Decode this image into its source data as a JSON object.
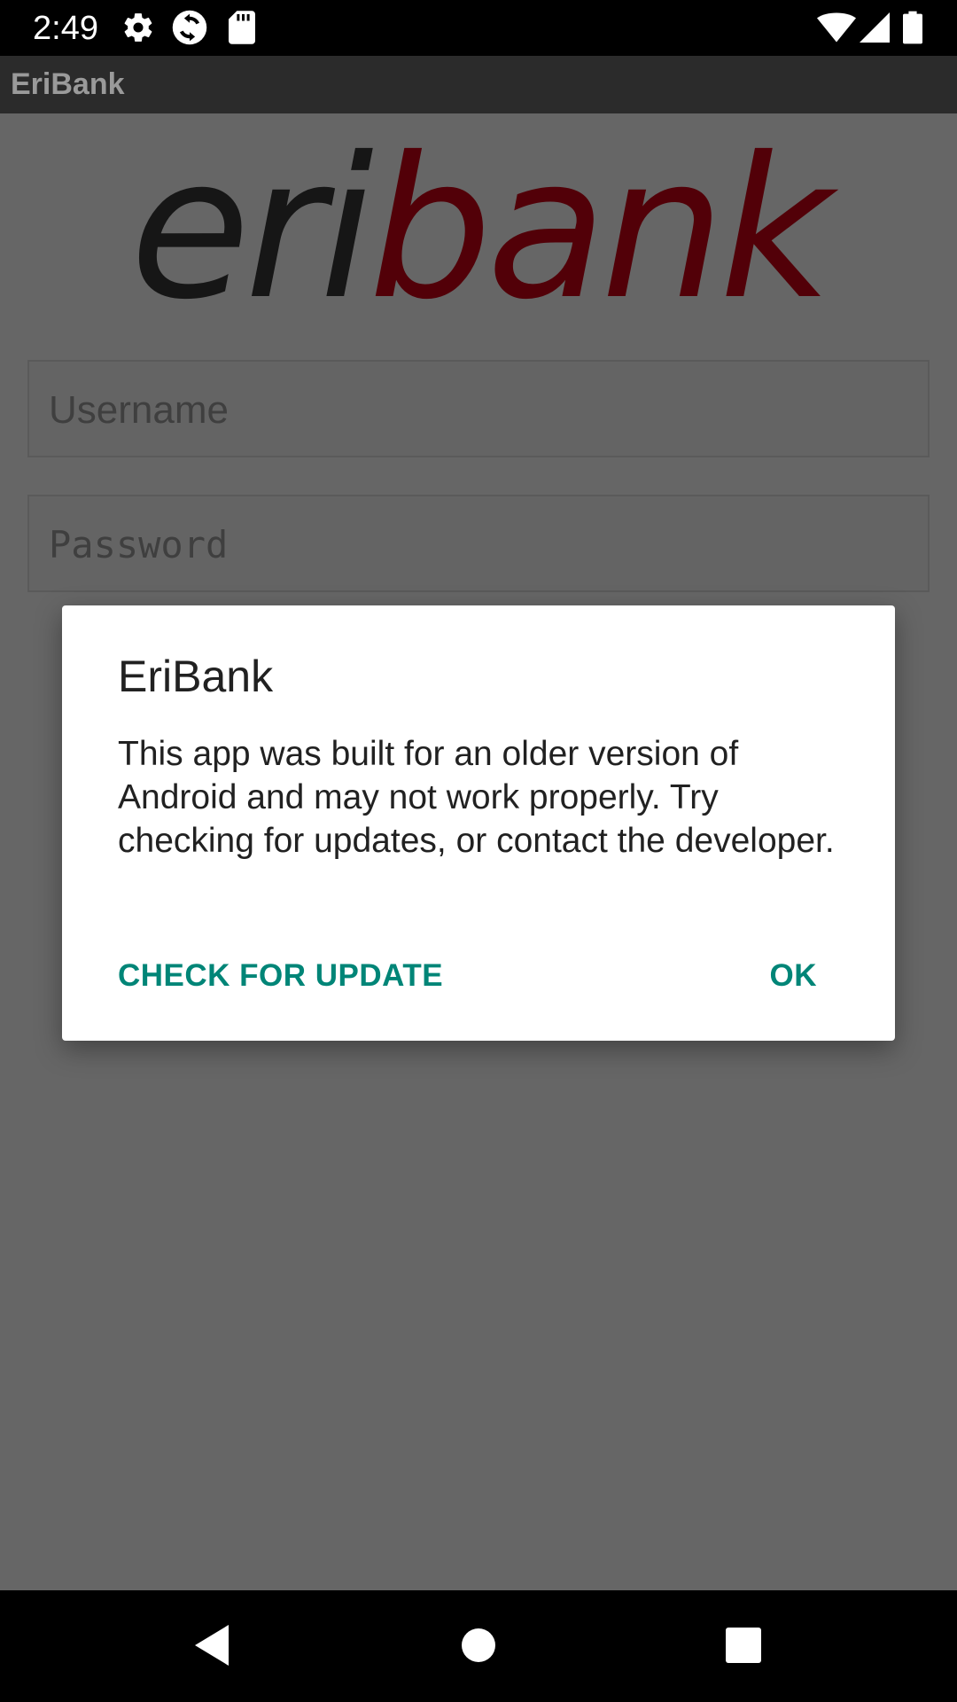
{
  "status_bar": {
    "time": "2:49",
    "icons": [
      "gear-icon",
      "sync-icon",
      "sd-card-icon",
      "wifi-icon",
      "signal-icon",
      "battery-icon"
    ]
  },
  "app_bar": {
    "title": "EriBank"
  },
  "logo": {
    "part_dark": "eri",
    "part_red": "bank",
    "color_dark": "#161616",
    "color_red": "#520008"
  },
  "login_form": {
    "username_placeholder": "Username",
    "password_placeholder": "Password"
  },
  "dialog": {
    "title": "EriBank",
    "message": "This app was built for an older version of Android and may not work properly. Try checking for updates, or contact the developer.",
    "buttons": {
      "check_update": "CHECK FOR UPDATE",
      "ok": "OK"
    },
    "accent_color": "#008577"
  },
  "nav_bar": {
    "icons": [
      "back-icon",
      "home-icon",
      "recents-icon"
    ]
  }
}
